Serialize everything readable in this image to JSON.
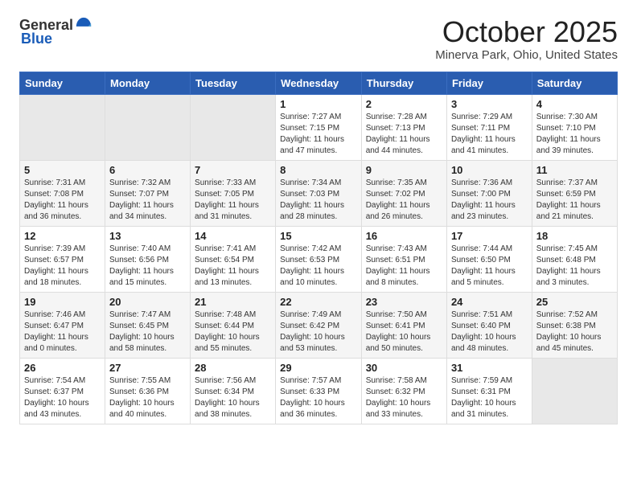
{
  "header": {
    "logo_general": "General",
    "logo_blue": "Blue",
    "month": "October 2025",
    "location": "Minerva Park, Ohio, United States"
  },
  "weekdays": [
    "Sunday",
    "Monday",
    "Tuesday",
    "Wednesday",
    "Thursday",
    "Friday",
    "Saturday"
  ],
  "weeks": [
    [
      {
        "day": "",
        "info": ""
      },
      {
        "day": "",
        "info": ""
      },
      {
        "day": "",
        "info": ""
      },
      {
        "day": "1",
        "info": "Sunrise: 7:27 AM\nSunset: 7:15 PM\nDaylight: 11 hours\nand 47 minutes."
      },
      {
        "day": "2",
        "info": "Sunrise: 7:28 AM\nSunset: 7:13 PM\nDaylight: 11 hours\nand 44 minutes."
      },
      {
        "day": "3",
        "info": "Sunrise: 7:29 AM\nSunset: 7:11 PM\nDaylight: 11 hours\nand 41 minutes."
      },
      {
        "day": "4",
        "info": "Sunrise: 7:30 AM\nSunset: 7:10 PM\nDaylight: 11 hours\nand 39 minutes."
      }
    ],
    [
      {
        "day": "5",
        "info": "Sunrise: 7:31 AM\nSunset: 7:08 PM\nDaylight: 11 hours\nand 36 minutes."
      },
      {
        "day": "6",
        "info": "Sunrise: 7:32 AM\nSunset: 7:07 PM\nDaylight: 11 hours\nand 34 minutes."
      },
      {
        "day": "7",
        "info": "Sunrise: 7:33 AM\nSunset: 7:05 PM\nDaylight: 11 hours\nand 31 minutes."
      },
      {
        "day": "8",
        "info": "Sunrise: 7:34 AM\nSunset: 7:03 PM\nDaylight: 11 hours\nand 28 minutes."
      },
      {
        "day": "9",
        "info": "Sunrise: 7:35 AM\nSunset: 7:02 PM\nDaylight: 11 hours\nand 26 minutes."
      },
      {
        "day": "10",
        "info": "Sunrise: 7:36 AM\nSunset: 7:00 PM\nDaylight: 11 hours\nand 23 minutes."
      },
      {
        "day": "11",
        "info": "Sunrise: 7:37 AM\nSunset: 6:59 PM\nDaylight: 11 hours\nand 21 minutes."
      }
    ],
    [
      {
        "day": "12",
        "info": "Sunrise: 7:39 AM\nSunset: 6:57 PM\nDaylight: 11 hours\nand 18 minutes."
      },
      {
        "day": "13",
        "info": "Sunrise: 7:40 AM\nSunset: 6:56 PM\nDaylight: 11 hours\nand 15 minutes."
      },
      {
        "day": "14",
        "info": "Sunrise: 7:41 AM\nSunset: 6:54 PM\nDaylight: 11 hours\nand 13 minutes."
      },
      {
        "day": "15",
        "info": "Sunrise: 7:42 AM\nSunset: 6:53 PM\nDaylight: 11 hours\nand 10 minutes."
      },
      {
        "day": "16",
        "info": "Sunrise: 7:43 AM\nSunset: 6:51 PM\nDaylight: 11 hours\nand 8 minutes."
      },
      {
        "day": "17",
        "info": "Sunrise: 7:44 AM\nSunset: 6:50 PM\nDaylight: 11 hours\nand 5 minutes."
      },
      {
        "day": "18",
        "info": "Sunrise: 7:45 AM\nSunset: 6:48 PM\nDaylight: 11 hours\nand 3 minutes."
      }
    ],
    [
      {
        "day": "19",
        "info": "Sunrise: 7:46 AM\nSunset: 6:47 PM\nDaylight: 11 hours\nand 0 minutes."
      },
      {
        "day": "20",
        "info": "Sunrise: 7:47 AM\nSunset: 6:45 PM\nDaylight: 10 hours\nand 58 minutes."
      },
      {
        "day": "21",
        "info": "Sunrise: 7:48 AM\nSunset: 6:44 PM\nDaylight: 10 hours\nand 55 minutes."
      },
      {
        "day": "22",
        "info": "Sunrise: 7:49 AM\nSunset: 6:42 PM\nDaylight: 10 hours\nand 53 minutes."
      },
      {
        "day": "23",
        "info": "Sunrise: 7:50 AM\nSunset: 6:41 PM\nDaylight: 10 hours\nand 50 minutes."
      },
      {
        "day": "24",
        "info": "Sunrise: 7:51 AM\nSunset: 6:40 PM\nDaylight: 10 hours\nand 48 minutes."
      },
      {
        "day": "25",
        "info": "Sunrise: 7:52 AM\nSunset: 6:38 PM\nDaylight: 10 hours\nand 45 minutes."
      }
    ],
    [
      {
        "day": "26",
        "info": "Sunrise: 7:54 AM\nSunset: 6:37 PM\nDaylight: 10 hours\nand 43 minutes."
      },
      {
        "day": "27",
        "info": "Sunrise: 7:55 AM\nSunset: 6:36 PM\nDaylight: 10 hours\nand 40 minutes."
      },
      {
        "day": "28",
        "info": "Sunrise: 7:56 AM\nSunset: 6:34 PM\nDaylight: 10 hours\nand 38 minutes."
      },
      {
        "day": "29",
        "info": "Sunrise: 7:57 AM\nSunset: 6:33 PM\nDaylight: 10 hours\nand 36 minutes."
      },
      {
        "day": "30",
        "info": "Sunrise: 7:58 AM\nSunset: 6:32 PM\nDaylight: 10 hours\nand 33 minutes."
      },
      {
        "day": "31",
        "info": "Sunrise: 7:59 AM\nSunset: 6:31 PM\nDaylight: 10 hours\nand 31 minutes."
      },
      {
        "day": "",
        "info": ""
      }
    ]
  ]
}
